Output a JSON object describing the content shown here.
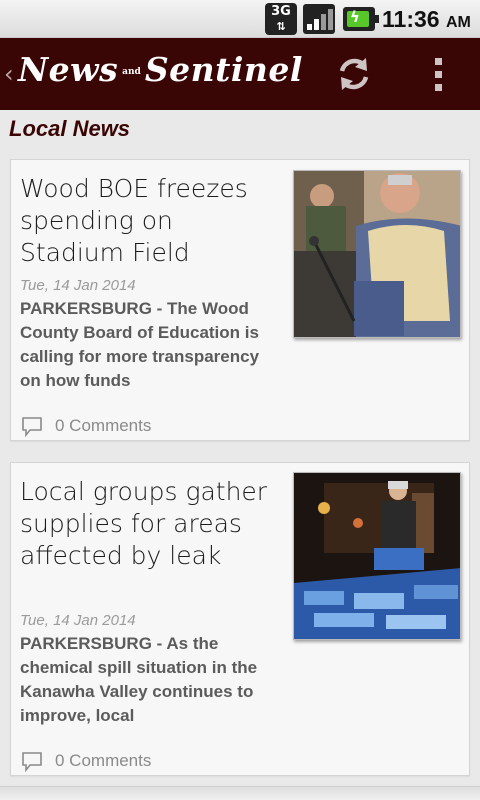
{
  "status_bar": {
    "network_type": "3G",
    "network_arrows": "⇅",
    "time": "11:36",
    "ampm": "AM",
    "signal_icon": "signal-bars-icon",
    "battery_icon": "battery-charging-icon",
    "battery_color": "#57c72a"
  },
  "action_bar": {
    "back_glyph": "‹",
    "logo_left": "News",
    "logo_and": "and",
    "logo_right": "Sentinel",
    "refresh_icon": "refresh-icon",
    "menu_icon": "overflow-menu-icon",
    "background_color": "#3a0505"
  },
  "section": {
    "title": "Local News"
  },
  "articles": [
    {
      "title": "Wood BOE freezes spending on Stadium Field",
      "date": "Tue, 14 Jan 2014",
      "summary": "PARKERSBURG - The Wood County Board of Education is calling for more transparency on how funds",
      "comments": "0 Comments"
    },
    {
      "title": "Local groups gather supplies for areas affected by leak",
      "date": "Tue, 14 Jan 2014",
      "summary": "PARKERSBURG - As the chemical spill situation in the Kanawha Valley continues to improve, local",
      "comments": "0 Comments"
    }
  ]
}
